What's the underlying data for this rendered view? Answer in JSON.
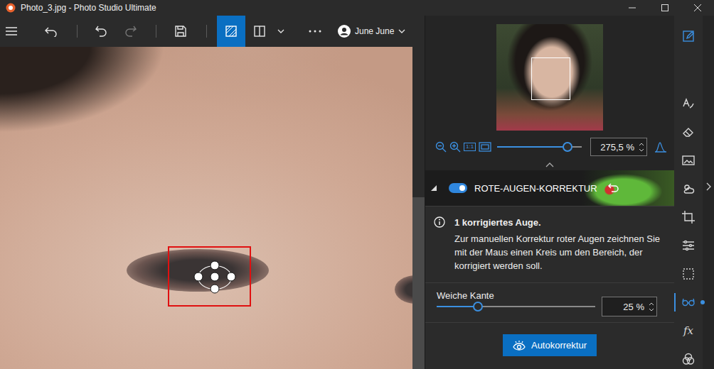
{
  "window": {
    "title": "Photo_3.jpg - Photo Studio Ultimate"
  },
  "toolbar": {
    "user": "June June",
    "view_selected": true,
    "redo_disabled": true
  },
  "navigator": {
    "one_to_one": "1:1",
    "zoom": "275,5 %",
    "level": 0.83
  },
  "panel": {
    "title": "ROTE-AUGEN-KORREKTUR",
    "on": true,
    "expanded": true,
    "info_title": "1 korrigiertes Auge.",
    "info_text": "Zur manuellen Korrektur roter Augen zeichnen Sie mit der Maus einen Kreis um den Bereich, der korrigiert werden soll.",
    "soft_edge": {
      "label": "Weiche Kante",
      "level": 0.26,
      "value": "25 %"
    },
    "button": "Autokorrektur"
  },
  "sidebar": {
    "items": [
      {
        "kind": "edit",
        "selected": true
      },
      {
        "kind": "text",
        "selected": false
      },
      {
        "kind": "eraser",
        "selected": false
      },
      {
        "kind": "frame",
        "selected": false
      },
      {
        "kind": "weather",
        "selected": false
      },
      {
        "kind": "crop",
        "selected": false
      },
      {
        "kind": "adjust",
        "selected": false
      },
      {
        "kind": "select",
        "selected": false
      },
      {
        "kind": "redeye",
        "selected": true
      },
      {
        "kind": "fx",
        "selected": false,
        "label": "fx"
      },
      {
        "kind": "circles",
        "selected": false
      }
    ]
  }
}
